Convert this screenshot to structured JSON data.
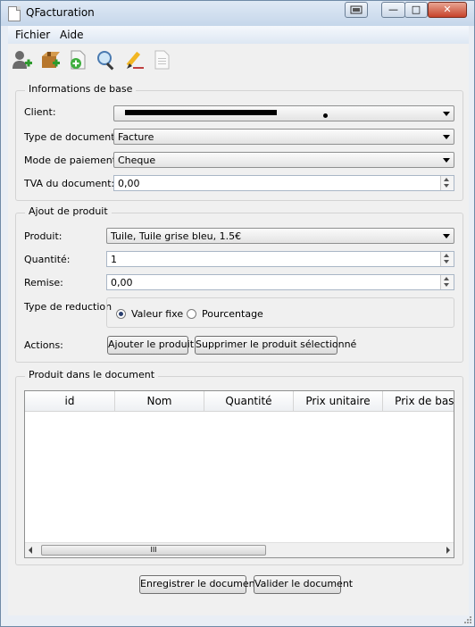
{
  "window": {
    "title": "QFacturation",
    "close_glyph": "✕",
    "minimize_glyph": "—",
    "maximize_glyph": "□"
  },
  "menu": {
    "items": [
      "Fichier",
      "Aide"
    ]
  },
  "toolbar": {
    "icons": [
      "add-user-icon",
      "add-product-icon",
      "add-document-icon",
      "search-icon",
      "edit-icon",
      "document-icon"
    ]
  },
  "info_base": {
    "title": "Informations de base",
    "client_label": "Client:",
    "client_value": "",
    "type_label": "Type de document:",
    "type_value": "Facture",
    "paiement_label": "Mode de paiement:",
    "paiement_value": "Cheque",
    "tva_label": "TVA du document:",
    "tva_value": "0,00"
  },
  "ajout_produit": {
    "title": "Ajout de produit",
    "produit_label": "Produit:",
    "produit_value": "Tuile, Tuile grise bleu, 1.5€",
    "quantite_label": "Quantité:",
    "quantite_value": "1",
    "remise_label": "Remise:",
    "remise_value": "0,00",
    "reduction_label": "Type de reduction",
    "radio_fixe": "Valeur fixe",
    "radio_pourcentage": "Pourcentage",
    "selected_reduction": "fixe",
    "actions_label": "Actions:",
    "btn_ajouter": "Ajouter le produit",
    "btn_supprimer": "Supprimer le produit sélectionné"
  },
  "produits_doc": {
    "title": "Produit dans le document",
    "columns": [
      "id",
      "Nom",
      "Quantité",
      "Prix unitaire",
      "Prix de base"
    ],
    "rows": [],
    "scroll_grip": "III"
  },
  "footer": {
    "btn_enregistrer": "Enregistrer le document",
    "btn_valider": "Valider le document"
  }
}
